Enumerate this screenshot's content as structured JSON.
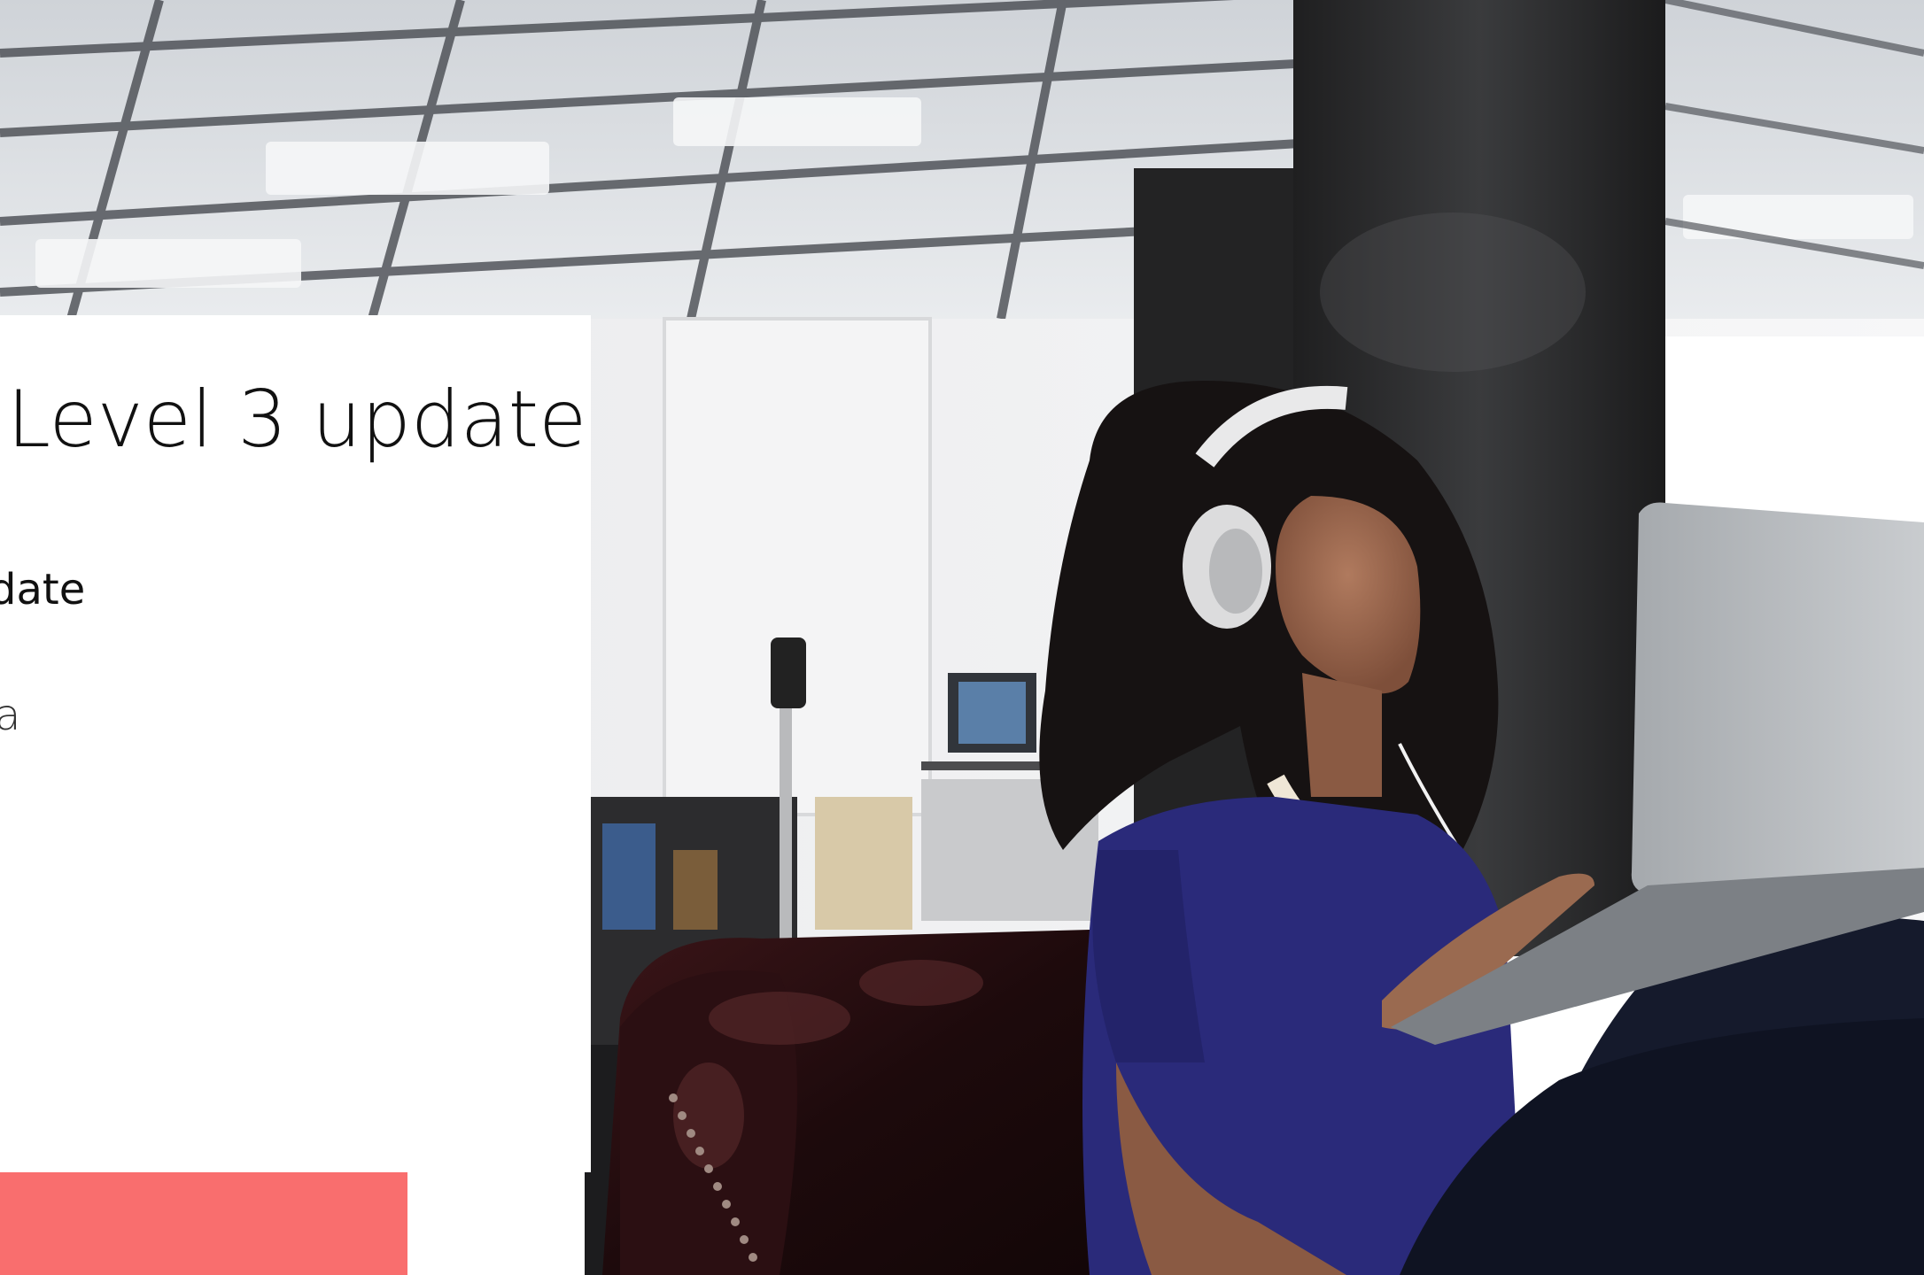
{
  "slide": {
    "title": "Level 3 update",
    "subtitle": "date",
    "detail": "a"
  },
  "colors": {
    "card": "#ffffff",
    "accent": "#f96e6e",
    "shirt": "#2a2a7a",
    "sofa": "#2a1214",
    "ceiling": "#dcdfe3",
    "pillar": "#2b2b2b"
  }
}
